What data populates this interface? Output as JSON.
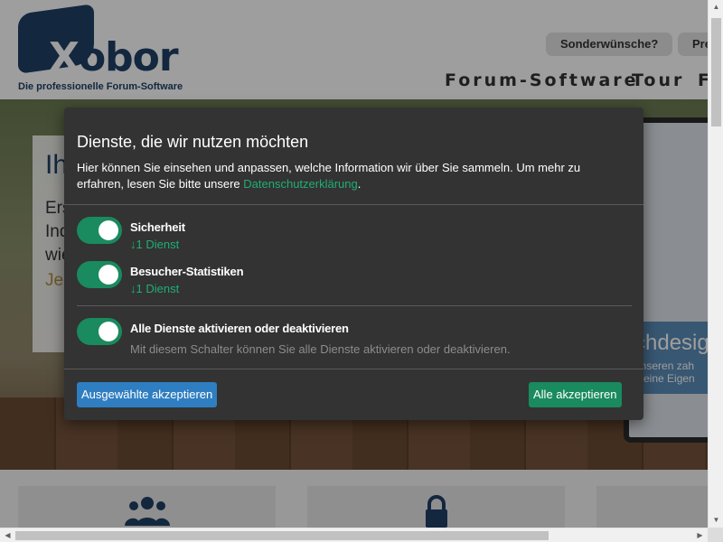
{
  "header": {
    "logo_text": "Xobor",
    "tagline": "Die professionelle Forum-Software",
    "buttons": [
      "Sonderwünsche?",
      "Pre"
    ],
    "nav": [
      "Forum-Software",
      "Tour",
      "F"
    ]
  },
  "hero": {
    "heading": "Ih",
    "paragraph_lines": [
      "Ers",
      "Ind",
      "wie"
    ],
    "action": "Je",
    "laptop_band_text": "chdesig",
    "laptop_lines": [
      "unseren zah",
      "e eine Eigen"
    ]
  },
  "consent": {
    "title": "Dienste, die wir nutzen möchten",
    "description": "Hier können Sie einsehen und anpassen, welche Information wir über Sie sammeln. Um mehr zu erfahren, lesen Sie bitte unsere ",
    "privacy_link": "Datenschutzerklärung",
    "description_end": ".",
    "purposes": [
      {
        "label": "Sicherheit",
        "count": "↓1 Dienst",
        "enabled": true
      },
      {
        "label": "Besucher-Statistiken",
        "count": "↓1 Dienst",
        "enabled": true
      }
    ],
    "toggle_all": {
      "label": "Alle Dienste aktivieren oder deaktivieren",
      "description": "Mit diesem Schalter können Sie alle Dienste aktivieren oder deaktivieren.",
      "enabled": true
    },
    "accept_selected": "Ausgewählte akzeptieren",
    "accept_all": "Alle akzeptieren",
    "colors": {
      "toggle_on": "#1a8a5f",
      "link": "#1fae75",
      "primary_button": "#2f7ec1",
      "background": "#333333"
    }
  },
  "icons": {
    "card1": "users-icon",
    "card2": "lock-icon"
  }
}
